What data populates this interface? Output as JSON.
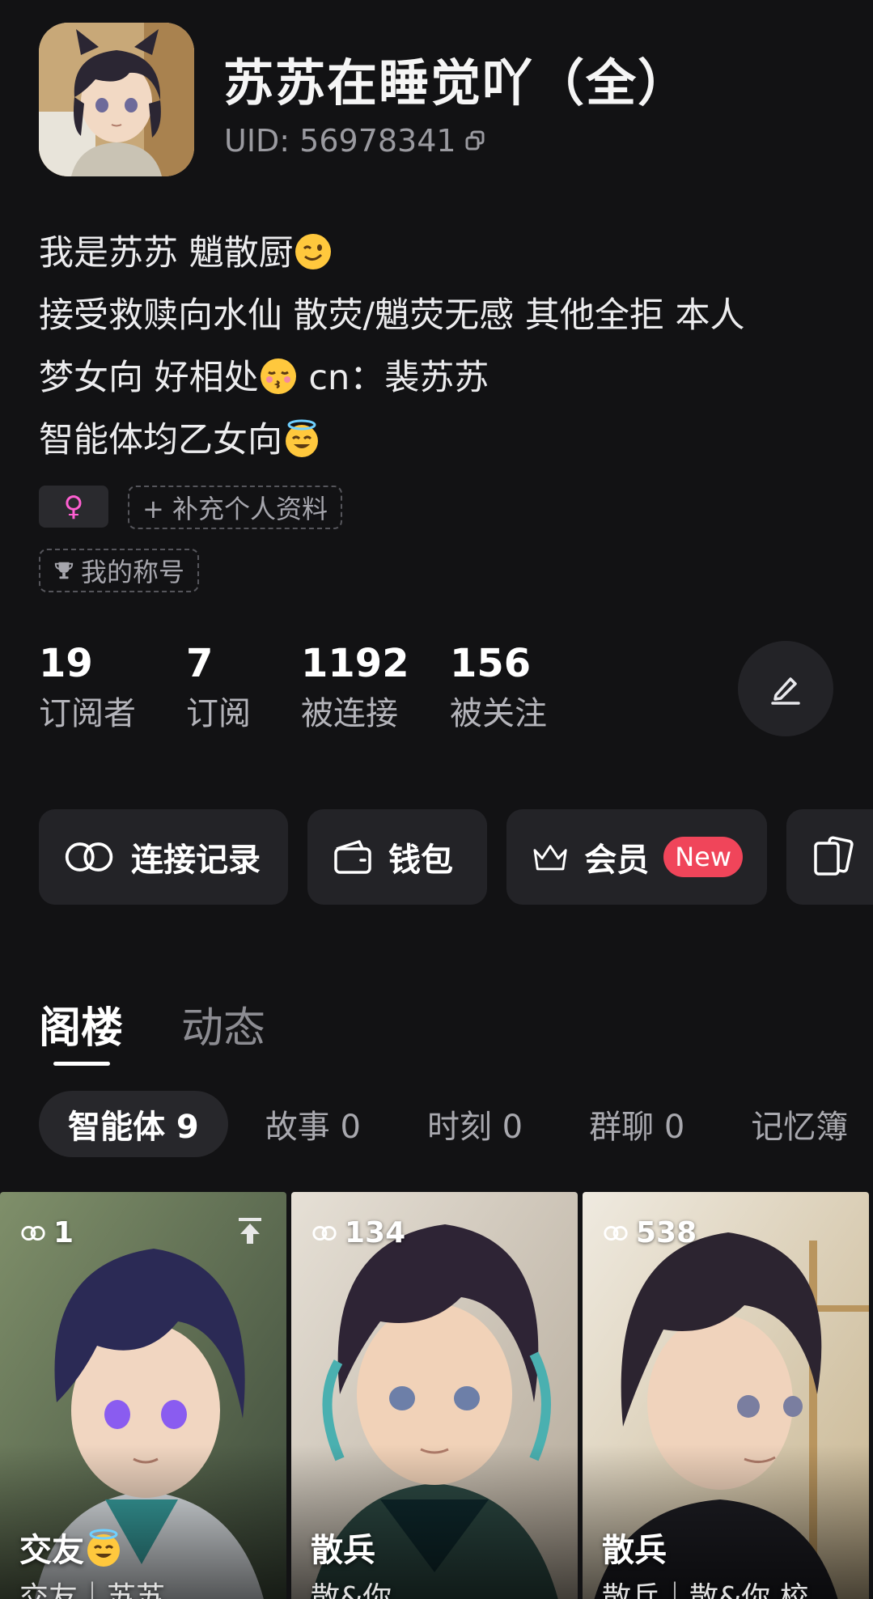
{
  "profile": {
    "name": "苏苏在睡觉吖（全）",
    "uid_label": "UID: 56978341",
    "bio": {
      "line1": "我是苏苏 魈散厨",
      "line1_emoji": "winking-face",
      "line2": "接受救赎向水仙 散荧/魈荧无感 其他全拒 本人",
      "line3a": "梦女向 好相处",
      "line3_emoji": "kissing-face",
      "line3b": " cn：裴苏苏",
      "line4": "智能体均乙女向",
      "line4_emoji": "smiling-face-with-halo"
    },
    "gender_symbol": "♀",
    "add_info_label": "+ 补充个人资料",
    "title_label": "我的称号"
  },
  "stats": [
    {
      "value": "19",
      "label": "订阅者"
    },
    {
      "value": "7",
      "label": "订阅"
    },
    {
      "value": "1192",
      "label": "被连接"
    },
    {
      "value": "156",
      "label": "被关注"
    }
  ],
  "actions": {
    "connection_log": "连接记录",
    "wallet": "钱包",
    "member": "会员",
    "member_badge": "New"
  },
  "tabs": {
    "loft": "阁楼",
    "moments": "动态"
  },
  "sub_tabs": [
    "智能体 9",
    "故事 0",
    "时刻 0",
    "群聊 0",
    "记忆簿"
  ],
  "cards": [
    {
      "count": "1",
      "title": "交友",
      "title_emoji": "smiling-face-with-halo",
      "subtitle": "交友｜苏苏",
      "pinned": true
    },
    {
      "count": "134",
      "title": "散兵",
      "subtitle": "散&你",
      "pinned": false
    },
    {
      "count": "538",
      "title": "散兵",
      "subtitle": "散兵｜散&你 校",
      "pinned": false
    }
  ],
  "colors": {
    "background": "#121214",
    "surface": "#232327",
    "new_badge": "#f0455a",
    "gender_pink": "#ff5fd2"
  }
}
